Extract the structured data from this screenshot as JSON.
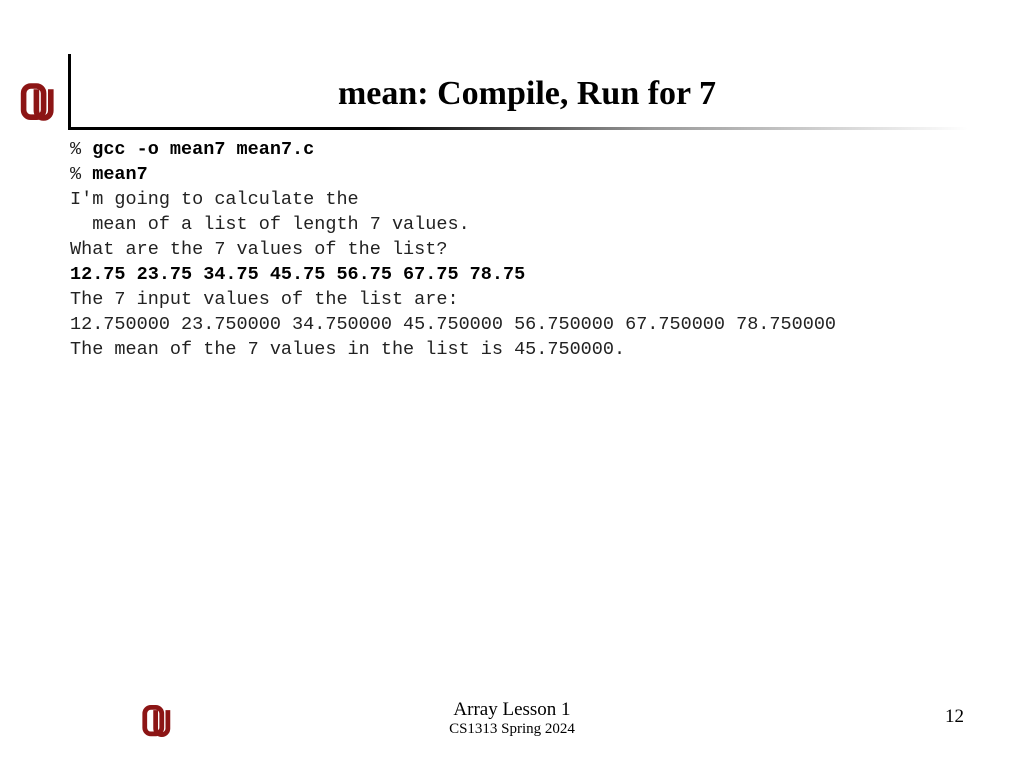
{
  "title": "mean: Compile, Run for 7",
  "prompt": "% ",
  "terminal": {
    "cmd1": "gcc -o mean7 mean7.c",
    "cmd2": "mean7",
    "line1": "I'm going to calculate the",
    "line2": "  mean of a list of length 7 values.",
    "line3": "What are the 7 values of the list?",
    "input": "12.75 23.75 34.75 45.75 56.75 67.75 78.75",
    "line4": "The 7 input values of the list are:",
    "line5": "12.750000 23.750000 34.750000 45.750000 56.750000 67.750000 78.750000",
    "line6": "The mean of the 7 values in the list is 45.750000."
  },
  "footer": {
    "title": "Array Lesson 1",
    "subtitle": "CS1313 Spring 2024",
    "page": "12"
  },
  "colors": {
    "ou_crimson": "#8c1515"
  }
}
